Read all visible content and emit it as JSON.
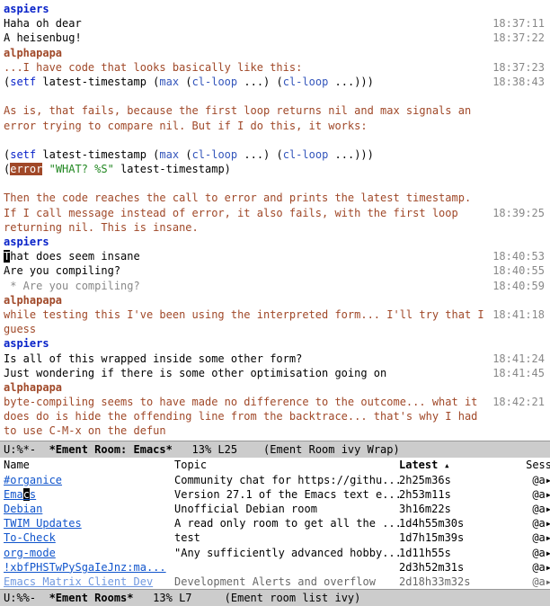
{
  "chat": {
    "lines": [
      {
        "type": "nick",
        "nick": "aspiers",
        "nickClass": "nick-aspiers",
        "ts": ""
      },
      {
        "type": "msg",
        "text": "Haha oh dear",
        "ts": "18:37:11"
      },
      {
        "type": "msg",
        "text": "A heisenbug!",
        "ts": "18:37:22"
      },
      {
        "type": "nick",
        "nick": "alphapapa",
        "nickClass": "nick-alphapapa",
        "ts": ""
      },
      {
        "type": "ap",
        "text": "...I have code that looks basically like this:",
        "ts": "18:37:23"
      },
      {
        "type": "code1",
        "ts": "18:38:43"
      },
      {
        "type": "blank",
        "ts": ""
      },
      {
        "type": "ap",
        "text": "As is, that fails, because the first loop returns nil and max signals an error trying to compare nil. But if I do this, it works:",
        "ts": ""
      },
      {
        "type": "blank",
        "ts": ""
      },
      {
        "type": "code1",
        "ts": ""
      },
      {
        "type": "code2",
        "ts": ""
      },
      {
        "type": "blank",
        "ts": ""
      },
      {
        "type": "ap",
        "text": "Then the code reaches the call to error and prints the latest timestamp.",
        "ts": ""
      },
      {
        "type": "ap",
        "text": "If I call message instead of error, it also fails, with the first loop returning nil. This is insane.",
        "ts": "18:39:25"
      },
      {
        "type": "nick",
        "nick": "aspiers",
        "nickClass": "nick-aspiers",
        "ts": ""
      },
      {
        "type": "msg-cursor",
        "pre": "",
        "cur": "T",
        "post": "hat does seem insane",
        "ts": "18:40:53"
      },
      {
        "type": "msg",
        "text": "Are you compiling?",
        "ts": "18:40:55"
      },
      {
        "type": "fold",
        "text": " * Are you compiling?",
        "ts": "18:40:59"
      },
      {
        "type": "nick",
        "nick": "alphapapa",
        "nickClass": "nick-alphapapa",
        "ts": ""
      },
      {
        "type": "ap",
        "text": "while testing this I've been using the interpreted form... I'll try that I guess",
        "ts": "18:41:18"
      },
      {
        "type": "nick",
        "nick": "aspiers",
        "nickClass": "nick-aspiers",
        "ts": ""
      },
      {
        "type": "msg",
        "text": "Is all of this wrapped inside some other form?",
        "ts": "18:41:24"
      },
      {
        "type": "msg",
        "text": "Just wondering if there is some other optimisation going on",
        "ts": "18:41:45"
      },
      {
        "type": "nick",
        "nick": "alphapapa",
        "nickClass": "nick-alphapapa",
        "ts": ""
      },
      {
        "type": "ap",
        "text": "byte-compiling seems to have made no difference to the outcome... what it does do is hide the offending line from the backtrace... that's why I had to use C-M-x on the defun",
        "ts": "18:42:21"
      }
    ],
    "code1": {
      "setf": "setf",
      "var": " latest-timestamp ",
      "max": "max",
      "loop": "cl-loop",
      "dots": " ...",
      "close": ")"
    },
    "code2": {
      "err": "error",
      "str": "\"WHAT? %S\"",
      "rest": " latest-timestamp)"
    }
  },
  "modeline1": {
    "left": "U:%*-  ",
    "buffer": "*Ement Room: Emacs*",
    "pos": "   13% L25    ",
    "mode": "(Ement Room ivy Wrap)"
  },
  "rooms": {
    "headers": {
      "name": "Name",
      "topic": "Topic",
      "latest": "Latest",
      "sess": "Sess"
    },
    "rows": [
      {
        "name": "#organice",
        "link": true,
        "topic": "Community chat for https://githu...",
        "latest": "2h25m36s",
        "sess": "@a▸"
      },
      {
        "name": "Emacs",
        "link": true,
        "cursor": 3,
        "topic": "Version 27.1 of the Emacs text e...",
        "latest": "2h53m11s",
        "sess": "@a▸"
      },
      {
        "name": "Debian",
        "link": true,
        "topic": "Unofficial Debian room",
        "latest": "3h16m22s",
        "sess": "@a▸"
      },
      {
        "name": "TWIM Updates",
        "link": true,
        "topic": "A read only room to get all the ...",
        "latest": "1d4h55m30s",
        "sess": "@a▸"
      },
      {
        "name": "To-Check",
        "link": true,
        "topic": "test",
        "latest": "1d7h15m39s",
        "sess": "@a▸"
      },
      {
        "name": "org-mode",
        "link": true,
        "topic": "\"Any sufficiently advanced hobby...",
        "latest": "1d11h55s",
        "sess": "@a▸"
      },
      {
        "name": "!xbfPHSTwPySgaIeJnz:ma...",
        "link": true,
        "topic": "",
        "latest": "2d3h52m31s",
        "sess": "@a▸"
      },
      {
        "name": "Emacs Matrix Client Dev",
        "link": true,
        "dim": true,
        "topic": "Development Alerts and overflow",
        "latest": "2d18h33m32s",
        "sess": "@a▸"
      }
    ]
  },
  "modeline2": {
    "left": "U:%%-  ",
    "buffer": "*Ement Rooms*",
    "pos": "   13% L7     ",
    "mode": "(Ement room list ivy)"
  }
}
